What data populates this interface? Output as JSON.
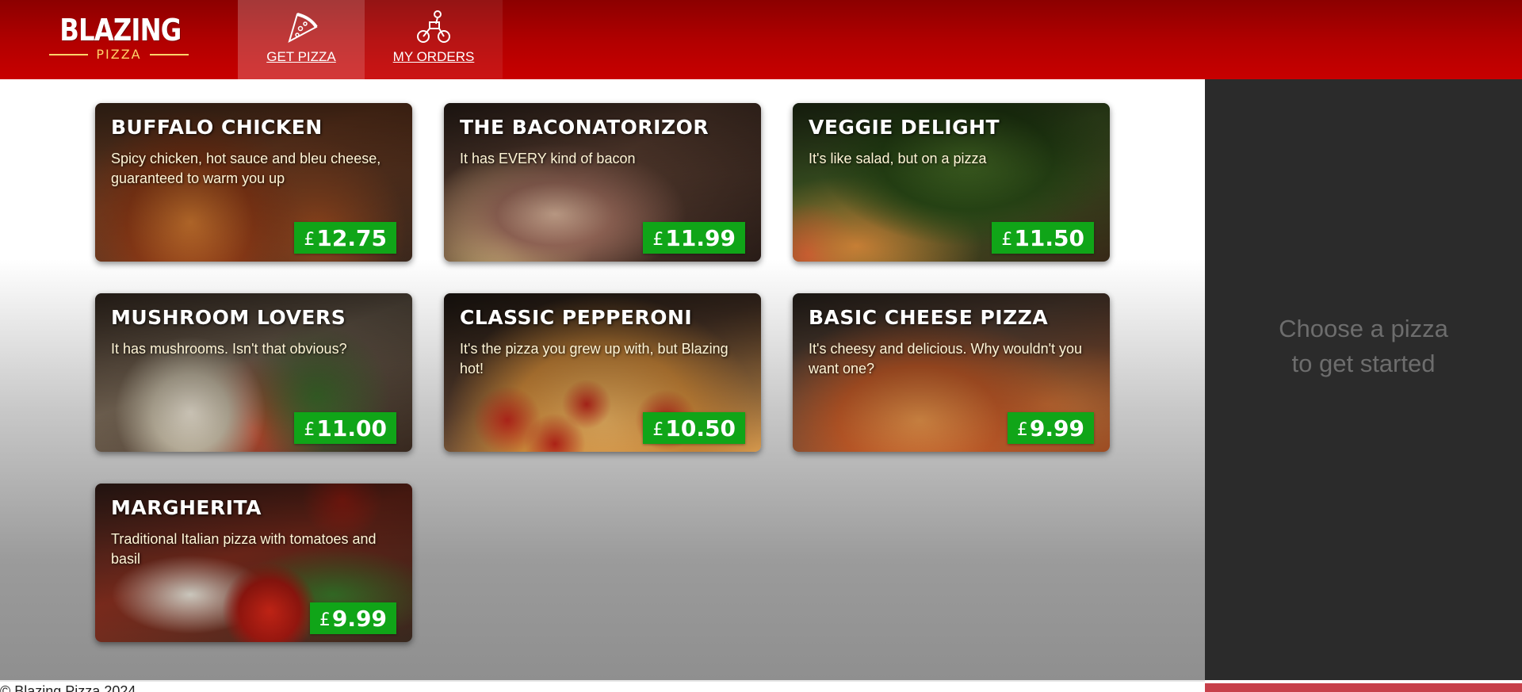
{
  "header": {
    "logo_main": "BLAZING",
    "logo_sub": "PIZZA",
    "nav": [
      {
        "label": "GET PIZZA",
        "icon": "pizza-slice-icon",
        "active": true
      },
      {
        "label": "MY ORDERS",
        "icon": "delivery-bike-icon",
        "active": false
      }
    ]
  },
  "currency_symbol": "£",
  "pizzas": [
    {
      "name": "BUFFALO CHICKEN",
      "description": "Spicy chicken, hot sauce and bleu cheese, guaranteed to warm you up",
      "price": "12.75"
    },
    {
      "name": "THE BACONATORIZOR",
      "description": "It has EVERY kind of bacon",
      "price": "11.99"
    },
    {
      "name": "VEGGIE DELIGHT",
      "description": "It's like salad, but on a pizza",
      "price": "11.50"
    },
    {
      "name": "MUSHROOM LOVERS",
      "description": "It has mushrooms. Isn't that obvious?",
      "price": "11.00"
    },
    {
      "name": "CLASSIC PEPPERONI",
      "description": "It's the pizza you grew up with, but Blazing hot!",
      "price": "10.50"
    },
    {
      "name": "BASIC CHEESE PIZZA",
      "description": "It's cheesy and delicious. Why wouldn't you want one?",
      "price": "9.99"
    },
    {
      "name": "MARGHERITA",
      "description": "Traditional Italian pizza with tomatoes and basil",
      "price": "9.99"
    }
  ],
  "sidebar": {
    "empty_message_line1": "Choose a pizza",
    "empty_message_line2": "to get started"
  },
  "footer": {
    "text": "© Blazing Pizza 2024"
  },
  "colors": {
    "header_red": "#b30000",
    "price_green": "#10a518",
    "sidebar_dark": "#2b2b2b",
    "logo_gold": "#ffd36b"
  }
}
